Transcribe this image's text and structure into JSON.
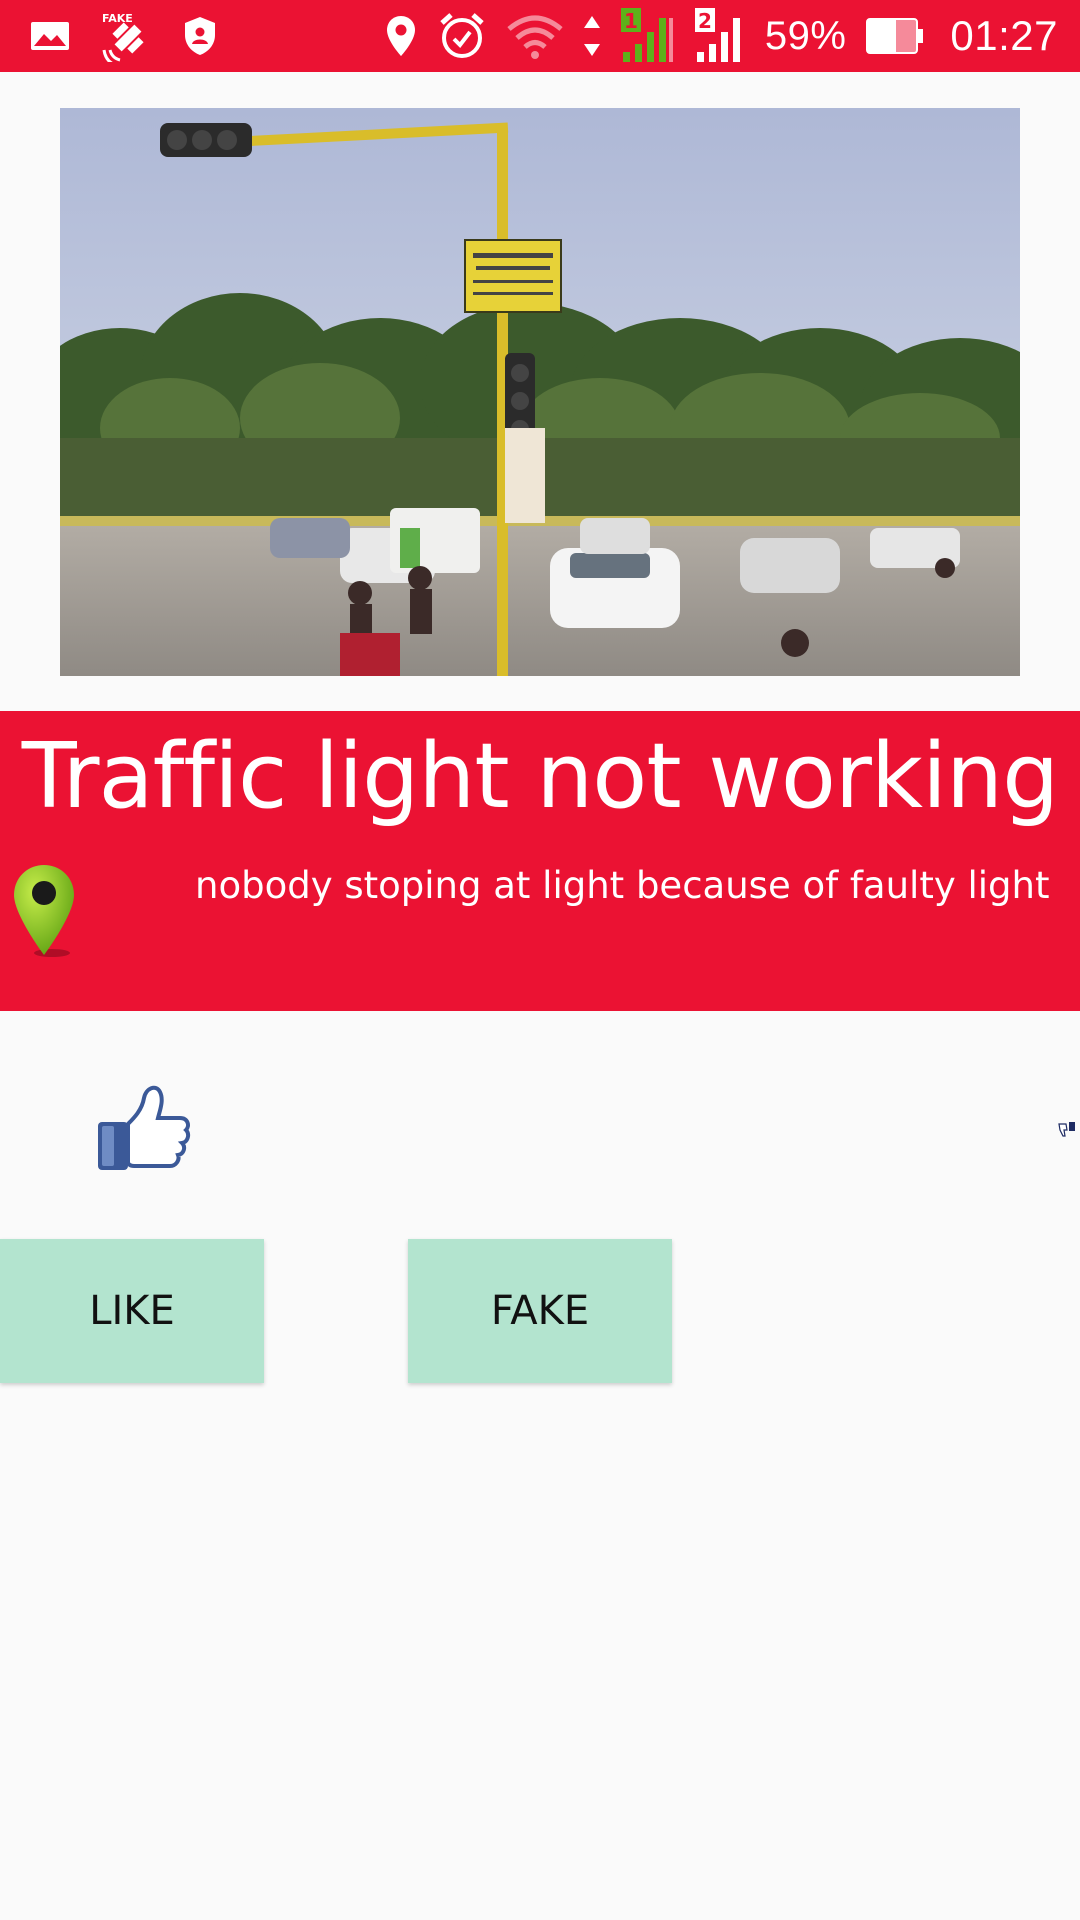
{
  "status_bar": {
    "icons_left": [
      "gallery-icon",
      "fake-gps-icon",
      "security-shield-icon"
    ],
    "fake_gps_label": "FAKE",
    "icons_right": [
      "location-pin-icon",
      "alarm-icon",
      "wifi-icon",
      "data-arrows-icon",
      "sim1-signal-icon",
      "sim2-signal-icon",
      "battery-icon"
    ],
    "sim1_label": "1",
    "sim2_label": "2",
    "battery_percent": "59%",
    "battery_level": 0.59,
    "time": "01:27",
    "background_color": "#EB1233"
  },
  "report": {
    "photo_icon": "traffic-intersection-photo",
    "title": "Traffic light not working",
    "description": "nobody stoping at light because of faulty light",
    "location_icon": "green-map-marker-icon",
    "panel_color": "#EB1233"
  },
  "reactions": {
    "thumbs_up_icon": "thumbs-up-icon",
    "thumbs_down_icon": "thumbs-down-icon"
  },
  "actions": {
    "like_label": "LIKE",
    "fake_label": "FAKE",
    "button_color": "#B3E4CF"
  }
}
